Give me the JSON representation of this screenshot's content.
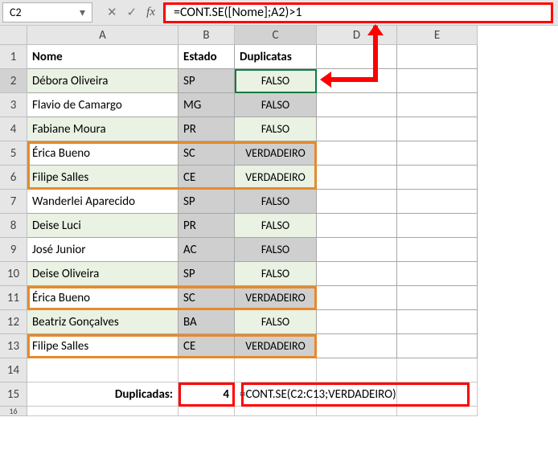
{
  "namebox": "C2",
  "formula": "=CONT.SE([Nome];A2)>1",
  "cols": {
    "A": "A",
    "B": "B",
    "C": "C",
    "D": "D",
    "E": "E"
  },
  "rownums": [
    "1",
    "2",
    "3",
    "4",
    "5",
    "6",
    "7",
    "8",
    "9",
    "10",
    "11",
    "12",
    "13",
    "14",
    "15",
    "16"
  ],
  "headers": {
    "nome": "Nome",
    "estado": "Estado",
    "dup": "Duplicatas"
  },
  "rows": [
    {
      "nome": "Débora Oliveira",
      "estado": "SP",
      "dup": "FALSO"
    },
    {
      "nome": "Flavio de Camargo",
      "estado": "MG",
      "dup": "FALSO"
    },
    {
      "nome": "Fabiane Moura",
      "estado": "PR",
      "dup": "FALSO"
    },
    {
      "nome": "Érica Bueno",
      "estado": "SC",
      "dup": "VERDADEIRO"
    },
    {
      "nome": "Filipe Salles",
      "estado": "CE",
      "dup": "VERDADEIRO"
    },
    {
      "nome": "Wanderlei Aparecido",
      "estado": "SP",
      "dup": "FALSO"
    },
    {
      "nome": "Deise Luci",
      "estado": "PR",
      "dup": "FALSO"
    },
    {
      "nome": "José Junior",
      "estado": "AC",
      "dup": "FALSO"
    },
    {
      "nome": "Deise Oliveira",
      "estado": "SP",
      "dup": "FALSO"
    },
    {
      "nome": "Érica Bueno",
      "estado": "SC",
      "dup": "VERDADEIRO"
    },
    {
      "nome": "Beatriz Gonçalves",
      "estado": "BA",
      "dup": "FALSO"
    },
    {
      "nome": "Filipe Salles",
      "estado": "CE",
      "dup": "VERDADEIRO"
    }
  ],
  "summary": {
    "label": "Duplicadas:",
    "count": "4",
    "formula": "=CONT.SE(C2:C13;VERDADEIRO)"
  },
  "chart_data": null
}
